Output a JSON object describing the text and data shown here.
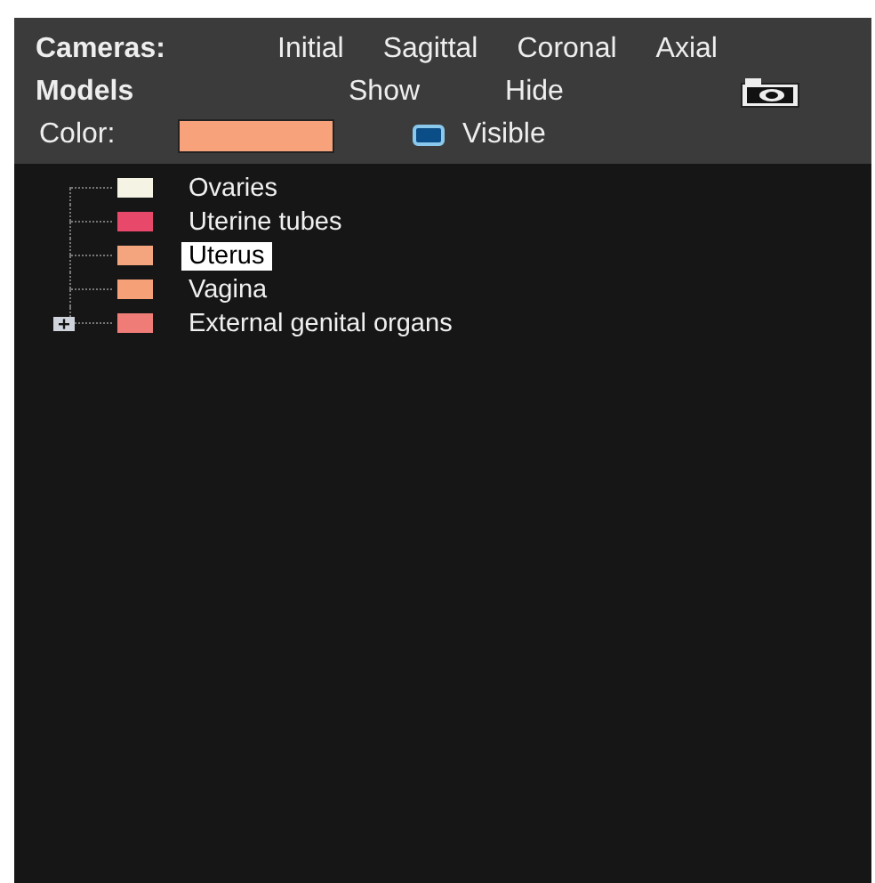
{
  "cameras": {
    "label": "Cameras:",
    "views": [
      {
        "label": "Initial"
      },
      {
        "label": "Sagittal"
      },
      {
        "label": "Coronal"
      },
      {
        "label": "Axial"
      }
    ]
  },
  "models": {
    "label": "Models",
    "show": "Show",
    "hide": "Hide"
  },
  "color_field": {
    "label": "Color:",
    "color": "#f7a27a"
  },
  "visible": {
    "label": "Visible",
    "checked": true
  },
  "tree": [
    {
      "label": "Ovaries",
      "color": "#f5f3e4",
      "selected": false
    },
    {
      "label": "Uterine tubes",
      "color": "#e8486a",
      "selected": false
    },
    {
      "label": "Uterus",
      "color": "#f4a57e",
      "selected": true
    },
    {
      "label": "Vagina",
      "color": "#f5a077",
      "selected": false
    },
    {
      "label": "External genital organs",
      "color": "#f07c78",
      "selected": false,
      "expanded": false
    }
  ]
}
